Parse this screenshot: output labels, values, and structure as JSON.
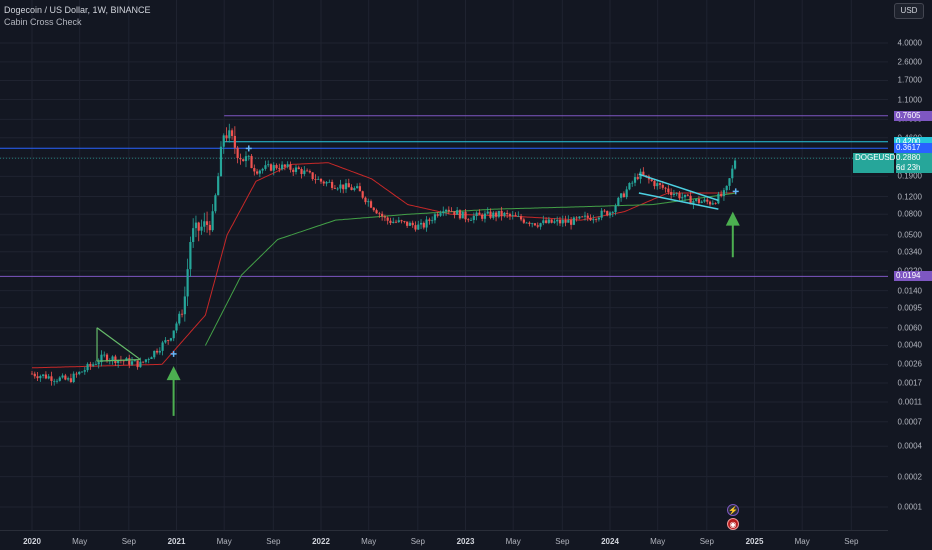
{
  "header": {
    "title": "Dogecoin / US Dollar, 1W, BINANCE",
    "indicator": "Cabin Cross Check",
    "currency": "USD"
  },
  "price_axis": {
    "labels": [
      "4.0000",
      "2.6000",
      "1.7000",
      "1.1000",
      "0.7000",
      "0.4600",
      "0.2900",
      "0.1900",
      "0.1200",
      "0.0800",
      "0.0500",
      "0.0340",
      "0.0220",
      "0.0140",
      "0.0095",
      "0.0060",
      "0.0040",
      "0.0026",
      "0.0017",
      "0.0011",
      "0.0007",
      "0.0004",
      "0.0002",
      "0.0001"
    ]
  },
  "time_axis": {
    "labels": [
      {
        "text": "2020",
        "bold": true
      },
      {
        "text": "May",
        "bold": false
      },
      {
        "text": "Sep",
        "bold": false
      },
      {
        "text": "2021",
        "bold": true
      },
      {
        "text": "May",
        "bold": false
      },
      {
        "text": "Sep",
        "bold": false
      },
      {
        "text": "2022",
        "bold": true
      },
      {
        "text": "May",
        "bold": false
      },
      {
        "text": "Sep",
        "bold": false
      },
      {
        "text": "2023",
        "bold": true
      },
      {
        "text": "May",
        "bold": false
      },
      {
        "text": "Sep",
        "bold": false
      },
      {
        "text": "2024",
        "bold": true
      },
      {
        "text": "May",
        "bold": false
      },
      {
        "text": "Sep",
        "bold": false
      },
      {
        "text": "2025",
        "bold": true
      },
      {
        "text": "May",
        "bold": false
      },
      {
        "text": "Sep",
        "bold": false
      }
    ]
  },
  "levels": [
    {
      "label": "0.7605",
      "value": 0.7605,
      "color": "#7e57c2"
    },
    {
      "label": "0.4200",
      "value": 0.42,
      "color": "#26c6da"
    },
    {
      "label": "0.3617",
      "value": 0.3617,
      "color": "#2962ff"
    },
    {
      "label": "0.0194",
      "value": 0.0194,
      "color": "#7e57c2"
    }
  ],
  "symbol_tag": {
    "symbol": "DOGEUSD",
    "price": "0.2880",
    "countdown": "6d 23h",
    "color": "#26a69a"
  },
  "colors": {
    "up": "#26a69a",
    "down": "#ef5350",
    "ma_fast": "#c62828",
    "ma_slow": "#43a047",
    "arrow": "#4caf50"
  },
  "icons": {
    "flash": "lightning-icon",
    "flag": "us-flag-icon"
  },
  "chart_data": {
    "type": "candlestick",
    "scale": "log",
    "price_range": [
      0.0001,
      5.5
    ],
    "weeks_start_year": 2020,
    "close_anchors": [
      {
        "t": 2020.0,
        "p": 0.0021
      },
      {
        "t": 2020.25,
        "p": 0.0018
      },
      {
        "t": 2020.5,
        "p": 0.0031
      },
      {
        "t": 2020.75,
        "p": 0.0026
      },
      {
        "t": 2020.95,
        "p": 0.0047
      },
      {
        "t": 2021.05,
        "p": 0.0095
      },
      {
        "t": 2021.1,
        "p": 0.05
      },
      {
        "t": 2021.25,
        "p": 0.07
      },
      {
        "t": 2021.33,
        "p": 0.55
      },
      {
        "t": 2021.45,
        "p": 0.3
      },
      {
        "t": 2021.55,
        "p": 0.22
      },
      {
        "t": 2021.7,
        "p": 0.24
      },
      {
        "t": 2021.85,
        "p": 0.22
      },
      {
        "t": 2022.0,
        "p": 0.17
      },
      {
        "t": 2022.25,
        "p": 0.14
      },
      {
        "t": 2022.45,
        "p": 0.07
      },
      {
        "t": 2022.7,
        "p": 0.06
      },
      {
        "t": 2022.85,
        "p": 0.095
      },
      {
        "t": 2023.0,
        "p": 0.075
      },
      {
        "t": 2023.25,
        "p": 0.08
      },
      {
        "t": 2023.5,
        "p": 0.065
      },
      {
        "t": 2023.75,
        "p": 0.068
      },
      {
        "t": 2024.0,
        "p": 0.085
      },
      {
        "t": 2024.2,
        "p": 0.2
      },
      {
        "t": 2024.35,
        "p": 0.15
      },
      {
        "t": 2024.55,
        "p": 0.11
      },
      {
        "t": 2024.7,
        "p": 0.105
      },
      {
        "t": 2024.8,
        "p": 0.13
      },
      {
        "t": 2024.87,
        "p": 0.288
      }
    ],
    "moving_averages": [
      {
        "name": "",
        "color": "#c62828",
        "anchors": [
          {
            "t": 2020.0,
            "p": 0.0024
          },
          {
            "t": 2020.9,
            "p": 0.0026
          },
          {
            "t": 2021.2,
            "p": 0.008
          },
          {
            "t": 2021.35,
            "p": 0.05
          },
          {
            "t": 2021.55,
            "p": 0.17
          },
          {
            "t": 2021.8,
            "p": 0.25
          },
          {
            "t": 2022.05,
            "p": 0.26
          },
          {
            "t": 2022.35,
            "p": 0.18
          },
          {
            "t": 2022.6,
            "p": 0.1
          },
          {
            "t": 2022.9,
            "p": 0.08
          },
          {
            "t": 2023.3,
            "p": 0.077
          },
          {
            "t": 2023.8,
            "p": 0.07
          },
          {
            "t": 2024.1,
            "p": 0.085
          },
          {
            "t": 2024.4,
            "p": 0.13
          },
          {
            "t": 2024.87,
            "p": 0.13
          }
        ]
      },
      {
        "name": "",
        "color": "#43a047",
        "anchors": [
          {
            "t": 2021.2,
            "p": 0.004
          },
          {
            "t": 2021.45,
            "p": 0.02
          },
          {
            "t": 2021.7,
            "p": 0.045
          },
          {
            "t": 2022.1,
            "p": 0.07
          },
          {
            "t": 2022.6,
            "p": 0.08
          },
          {
            "t": 2023.2,
            "p": 0.09
          },
          {
            "t": 2023.8,
            "p": 0.095
          },
          {
            "t": 2024.3,
            "p": 0.1
          },
          {
            "t": 2024.7,
            "p": 0.12
          },
          {
            "t": 2024.87,
            "p": 0.13
          }
        ]
      }
    ],
    "annotations": [
      {
        "kind": "wedge",
        "t0": 2020.45,
        "p0": 0.006,
        "t1": 2020.75,
        "p1": 0.0029,
        "t2": 2020.45,
        "p2": 0.0028
      },
      {
        "kind": "channel",
        "t0": 2024.2,
        "p0": 0.2,
        "t1": 2024.75,
        "p1": 0.11,
        "t2": 2024.2,
        "p2": 0.13,
        "t3": 2024.75,
        "p3": 0.09
      },
      {
        "kind": "cross",
        "t": 2020.98,
        "p": 0.0033
      },
      {
        "kind": "cross",
        "t": 2021.5,
        "p": 0.36
      },
      {
        "kind": "cross",
        "t": 2024.87,
        "p": 0.135
      },
      {
        "kind": "arrow-up",
        "t": 2020.98,
        "p_from": 0.0008,
        "p_to": 0.0025
      },
      {
        "kind": "arrow-up",
        "t": 2024.85,
        "p_from": 0.03,
        "p_to": 0.085
      }
    ]
  }
}
